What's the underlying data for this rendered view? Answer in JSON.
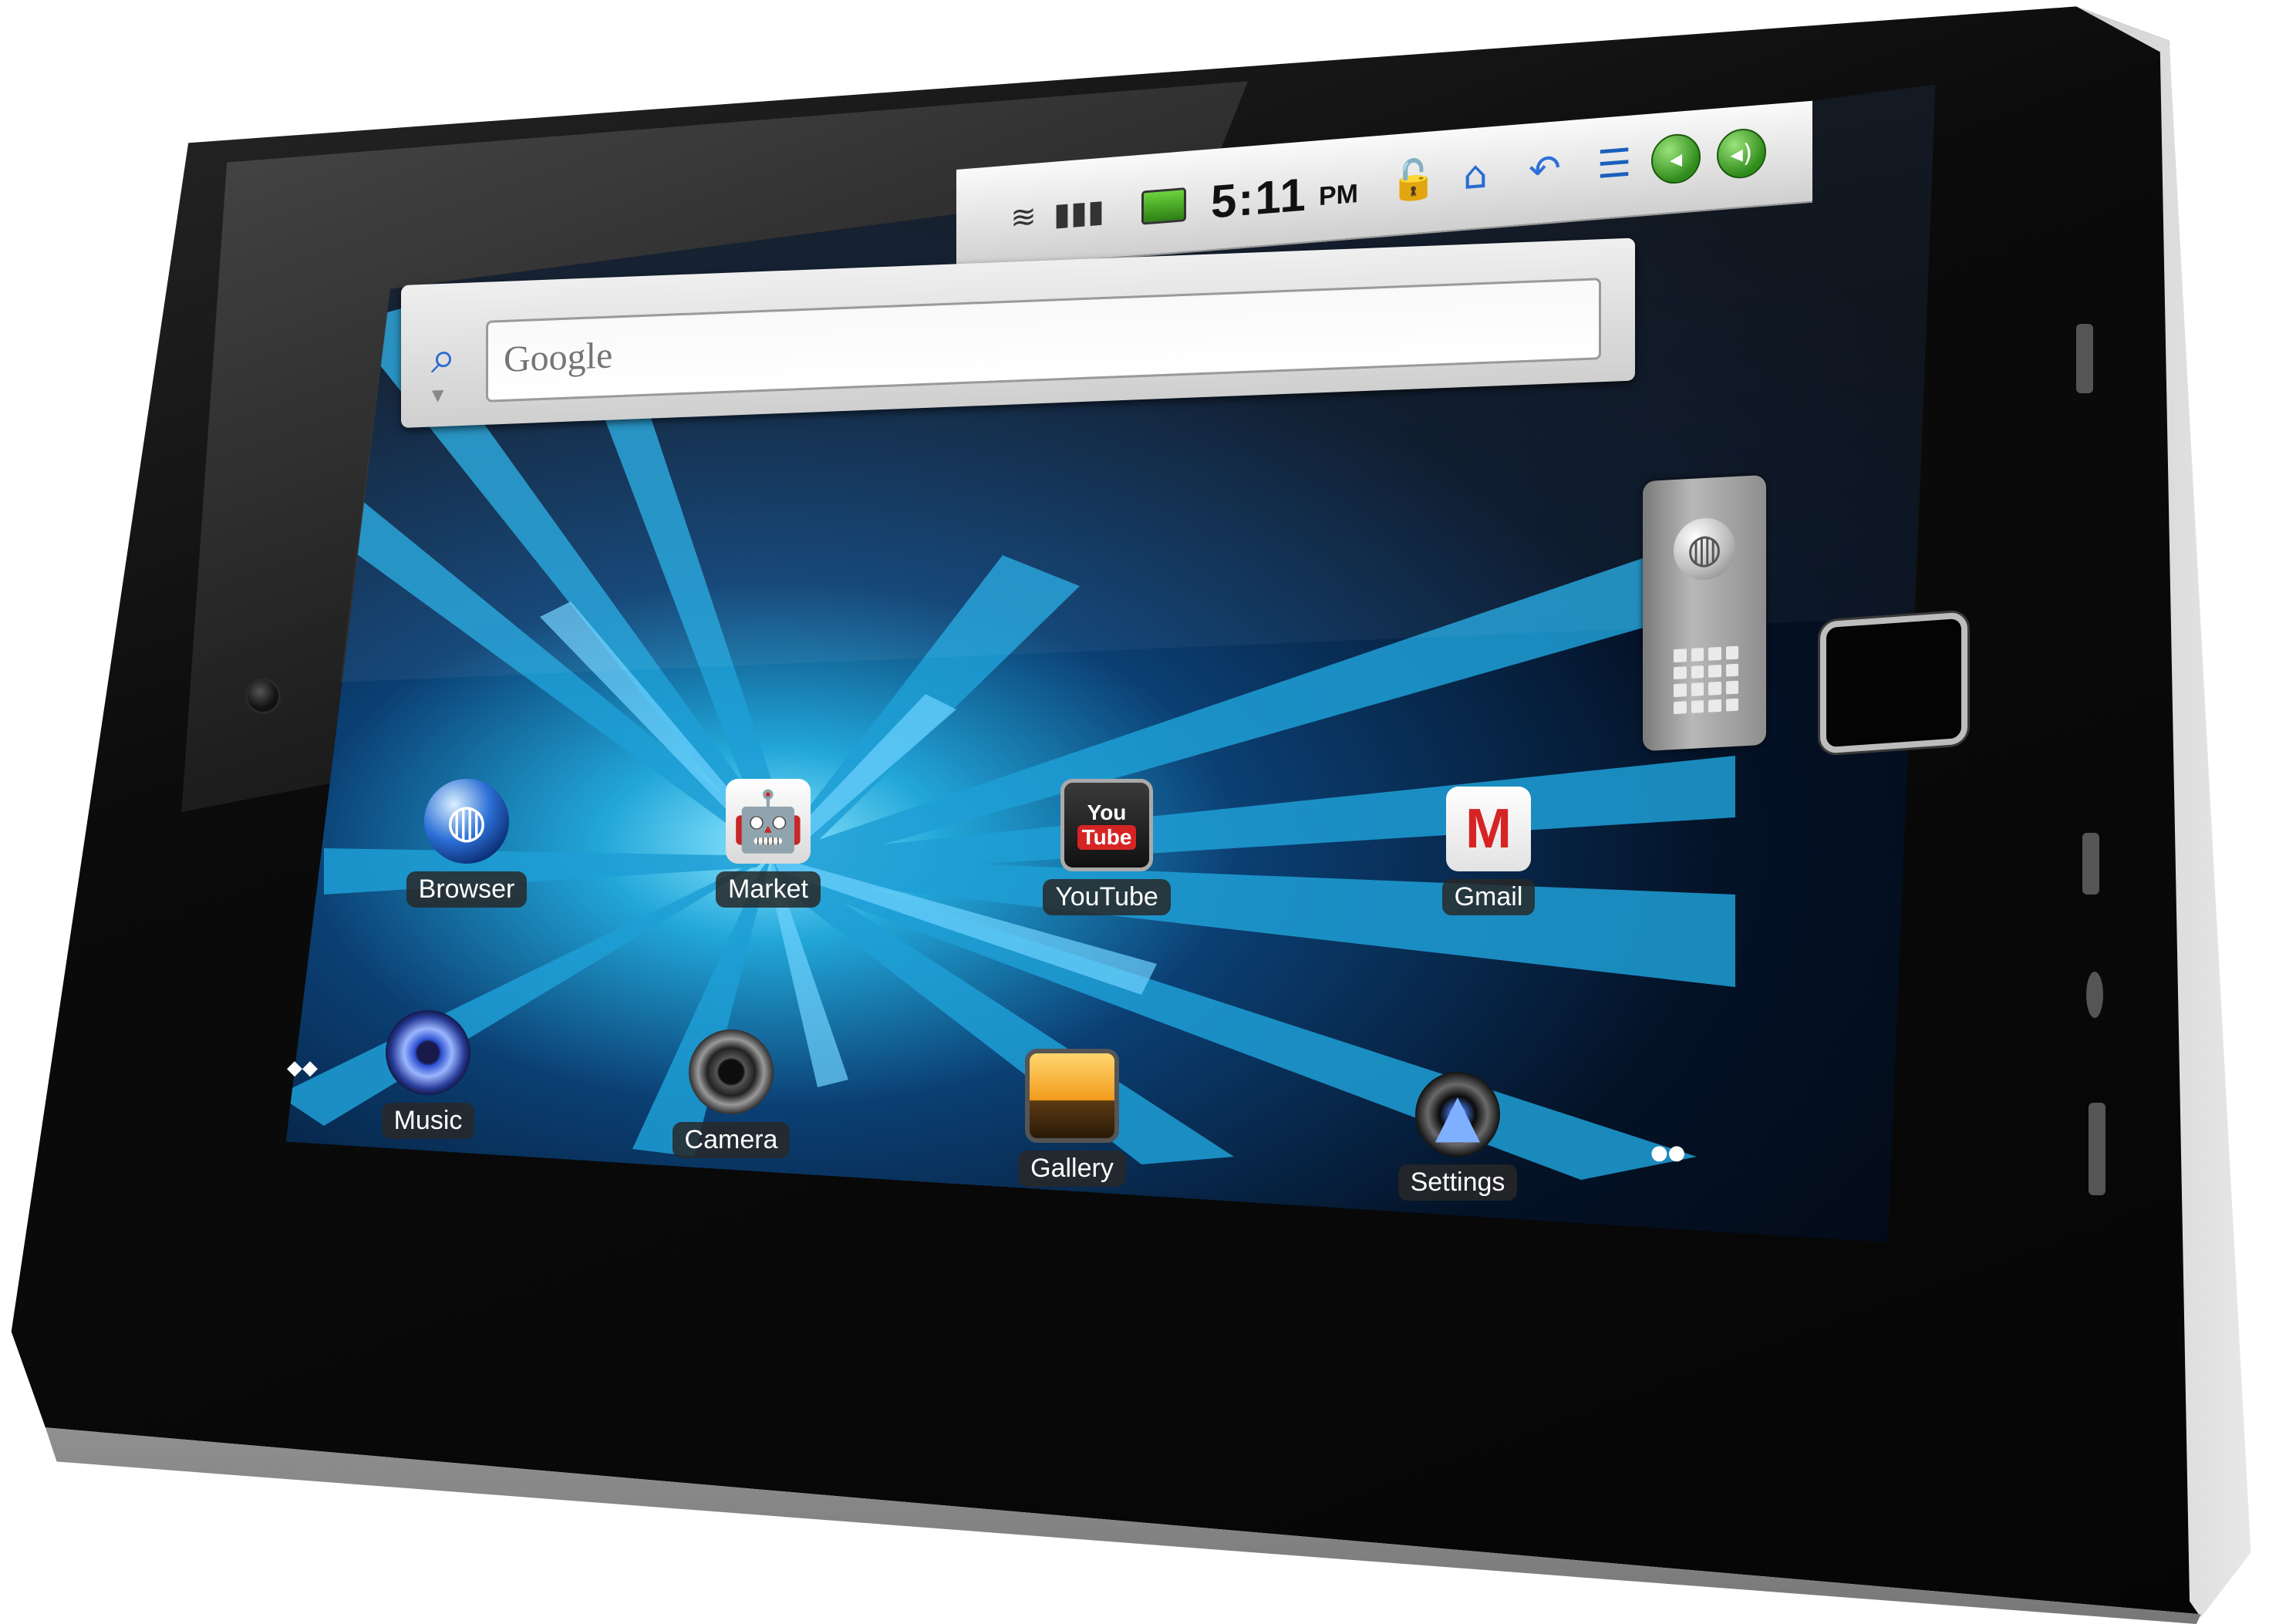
{
  "status_bar": {
    "time": "5:11",
    "ampm": "PM",
    "icons": [
      "wifi-icon",
      "signal-icon",
      "battery-icon",
      "lock-icon",
      "home-icon",
      "back-icon",
      "menu-icon",
      "volume-down-icon",
      "volume-up-icon"
    ],
    "battery_color": "#3ea21d"
  },
  "search": {
    "placeholder": "Google"
  },
  "apps": [
    {
      "label": "Browser"
    },
    {
      "label": "Market"
    },
    {
      "label": "YouTube"
    },
    {
      "label": "Gmail"
    },
    {
      "label": "Music"
    },
    {
      "label": "Camera"
    },
    {
      "label": "Gallery"
    },
    {
      "label": "Settings"
    }
  ],
  "youtube_icon": {
    "top": "You",
    "bottom": "Tube"
  },
  "gmail_icon": {
    "letter": "M"
  },
  "colors": {
    "wallpaper_accent": "#22a7d9",
    "label_bg": "#282828"
  }
}
